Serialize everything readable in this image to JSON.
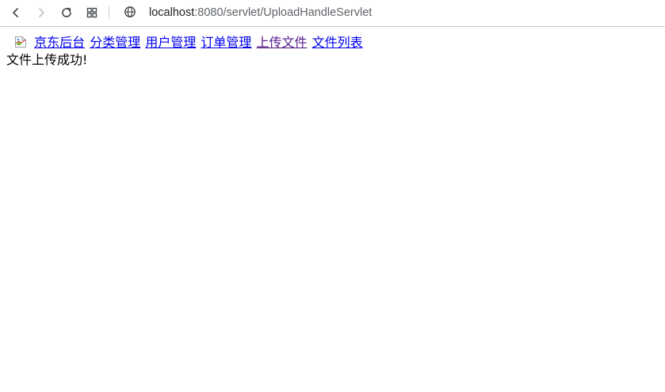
{
  "browser": {
    "url_host": "localhost",
    "url_rest": ":8080/servlet/UploadHandleServlet",
    "icons": [
      "back-icon",
      "forward-icon",
      "reload-icon",
      "tabs-grid-icon",
      "globe-icon"
    ]
  },
  "nav": {
    "logo_alt": "",
    "links": [
      {
        "label": "京东后台"
      },
      {
        "label": "分类管理"
      },
      {
        "label": "用户管理"
      },
      {
        "label": "订单管理"
      },
      {
        "label": "上传文件"
      },
      {
        "label": "文件列表"
      }
    ]
  },
  "message": "文件上传成功!",
  "colors": {
    "link": "#0000ee",
    "visited_link": "#551a8b",
    "text": "#000000"
  }
}
